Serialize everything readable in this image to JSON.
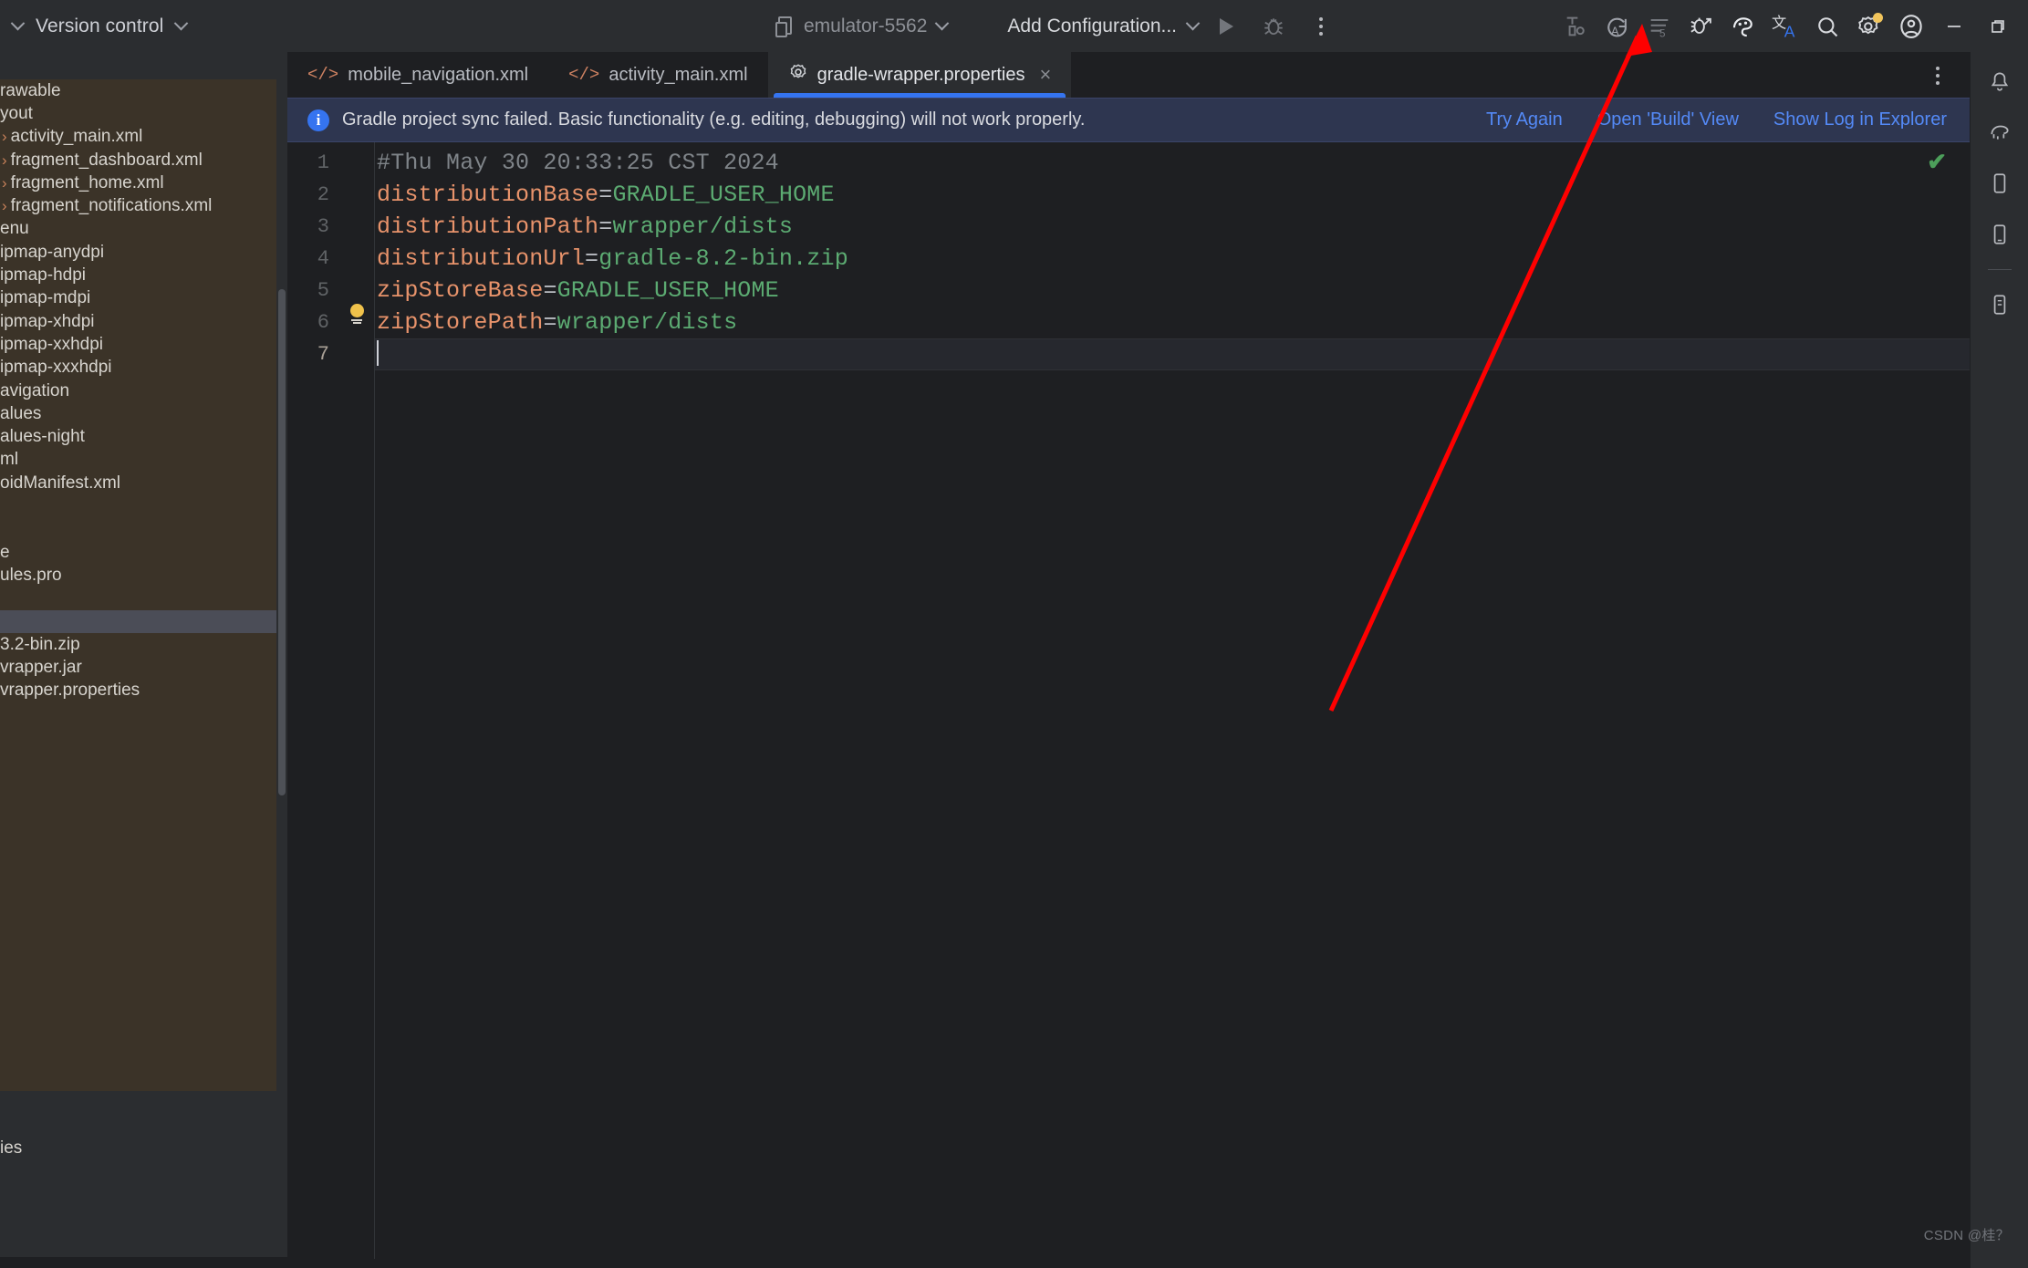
{
  "toolbar": {
    "vcs_label": "Version control",
    "device_name": "emulator-5562",
    "config_label": "Add Configuration...",
    "icons": {
      "menu_chevron": "chevron-down-icon",
      "device": "device-icon",
      "run": "run-icon",
      "debug": "debug-icon",
      "more": "more-vertical-icon",
      "build": "build-hammer-icon",
      "sync": "sync-gradle-icon",
      "todo": "list-icon",
      "device_manager": "bug-device-icon",
      "layout_inspector": "layout-inspector-icon",
      "translate": "translate-icon",
      "search": "search-icon",
      "settings": "gear-icon",
      "account": "account-icon",
      "minimize": "minimize-icon",
      "maximize": "maximize-icon"
    }
  },
  "tabs": [
    {
      "label": "mobile_navigation.xml",
      "icon": "xml-file-icon",
      "active": false,
      "closable": false
    },
    {
      "label": "activity_main.xml",
      "icon": "xml-file-icon",
      "active": false,
      "closable": false
    },
    {
      "label": "gradle-wrapper.properties",
      "icon": "properties-file-icon",
      "active": true,
      "closable": true
    }
  ],
  "banner": {
    "icon": "info-icon",
    "icon_char": "i",
    "message": "Gradle project sync failed. Basic functionality (e.g. editing, debugging) will not work properly.",
    "actions": [
      "Try Again",
      "Open 'Build' View",
      "Show Log in Explorer"
    ]
  },
  "editor": {
    "gutter_lines": [
      "1",
      "2",
      "3",
      "4",
      "5",
      "6",
      "7"
    ],
    "current_line": 7,
    "inspection_status": "ok-checkmark",
    "lines": [
      {
        "n": 1,
        "type": "comment",
        "comment": "#Thu May 30 20:33:25 CST 2024"
      },
      {
        "n": 2,
        "type": "pair",
        "key": "distributionBase",
        "eq": "=",
        "value": "GRADLE_USER_HOME"
      },
      {
        "n": 3,
        "type": "pair",
        "key": "distributionPath",
        "eq": "=",
        "value": "wrapper/dists"
      },
      {
        "n": 4,
        "type": "pair",
        "key": "distributionUrl",
        "eq": "=",
        "value": "gradle-8.2-bin.zip"
      },
      {
        "n": 5,
        "type": "pair",
        "key": "zipStoreBase",
        "eq": "=",
        "value": "GRADLE_USER_HOME"
      },
      {
        "n": 6,
        "type": "pair",
        "key": "zipStorePath",
        "eq": "=",
        "value": "wrapper/dists"
      },
      {
        "n": 7,
        "type": "empty",
        "text": ""
      }
    ],
    "intention_bulb": "lightbulb-icon"
  },
  "sidebar": {
    "rows": [
      {
        "label": "rawable",
        "chevron": false,
        "selected": false
      },
      {
        "label": "yout",
        "chevron": false,
        "selected": false
      },
      {
        "label": "activity_main.xml",
        "chevron": true,
        "selected": false
      },
      {
        "label": "fragment_dashboard.xml",
        "chevron": true,
        "selected": false
      },
      {
        "label": "fragment_home.xml",
        "chevron": true,
        "selected": false
      },
      {
        "label": "fragment_notifications.xml",
        "chevron": true,
        "selected": false
      },
      {
        "label": "enu",
        "chevron": false,
        "selected": false
      },
      {
        "label": "ipmap-anydpi",
        "chevron": false,
        "selected": false
      },
      {
        "label": "ipmap-hdpi",
        "chevron": false,
        "selected": false
      },
      {
        "label": "ipmap-mdpi",
        "chevron": false,
        "selected": false
      },
      {
        "label": "ipmap-xhdpi",
        "chevron": false,
        "selected": false
      },
      {
        "label": "ipmap-xxhdpi",
        "chevron": false,
        "selected": false
      },
      {
        "label": "ipmap-xxxhdpi",
        "chevron": false,
        "selected": false
      },
      {
        "label": "avigation",
        "chevron": false,
        "selected": false
      },
      {
        "label": "alues",
        "chevron": false,
        "selected": false
      },
      {
        "label": "alues-night",
        "chevron": false,
        "selected": false
      },
      {
        "label": "ml",
        "chevron": false,
        "selected": false
      },
      {
        "label": "oidManifest.xml",
        "chevron": false,
        "selected": false
      },
      {
        "label": "",
        "chevron": false,
        "selected": false
      },
      {
        "label": "",
        "chevron": false,
        "selected": false
      },
      {
        "label": "e",
        "chevron": false,
        "selected": false
      },
      {
        "label": "ules.pro",
        "chevron": false,
        "selected": false
      },
      {
        "label": "",
        "chevron": false,
        "selected": false
      },
      {
        "label": "",
        "chevron": false,
        "selected": true
      },
      {
        "label": "3.2-bin.zip",
        "chevron": false,
        "selected": false
      },
      {
        "label": "vrapper.jar",
        "chevron": false,
        "selected": false
      },
      {
        "label": "vrapper.properties",
        "chevron": false,
        "selected": false
      }
    ],
    "bottom_rows": [
      {
        "label": ""
      },
      {
        "label": ""
      },
      {
        "label": "ies"
      }
    ]
  },
  "right_strip": {
    "icons": [
      "notifications-icon",
      "gradle-elephant-icon",
      "device-manager-icon",
      "emulator-icon",
      "divider",
      "device-file-explorer-icon"
    ]
  },
  "annotation": {
    "type": "red-arrow",
    "points_to": "sync-gradle-icon"
  },
  "watermark": "CSDN @桂？",
  "colors": {
    "accent_blue": "#3574f0",
    "link_blue": "#548af7",
    "banner_bg": "#2e3650",
    "editor_bg": "#1e1f22",
    "panel_bg": "#2b2d30",
    "tree_bg": "#3b3328",
    "selection": "#4b4d57",
    "key_orange": "#e8936b",
    "value_green": "#5cab72",
    "comment_gray": "#7f8489",
    "ok_green": "#4c9e5a",
    "badge_yellow": "#f2c55c",
    "arrow_red": "#ff0000"
  }
}
